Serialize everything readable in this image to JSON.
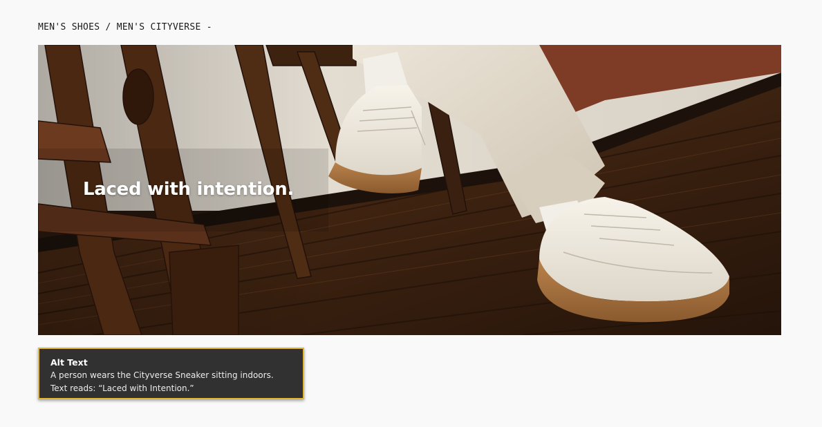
{
  "breadcrumb": {
    "text": "MEN'S SHOES / MEN'S CITYVERSE -"
  },
  "hero": {
    "headline": "Laced with intention."
  },
  "alt_text_card": {
    "title": "Alt Text",
    "body": "A person wears the Cityverse Sneaker sitting indoors. Text reads: “Laced with Intention.”",
    "border_color": "#e3b62b",
    "background_color": "#313131"
  }
}
